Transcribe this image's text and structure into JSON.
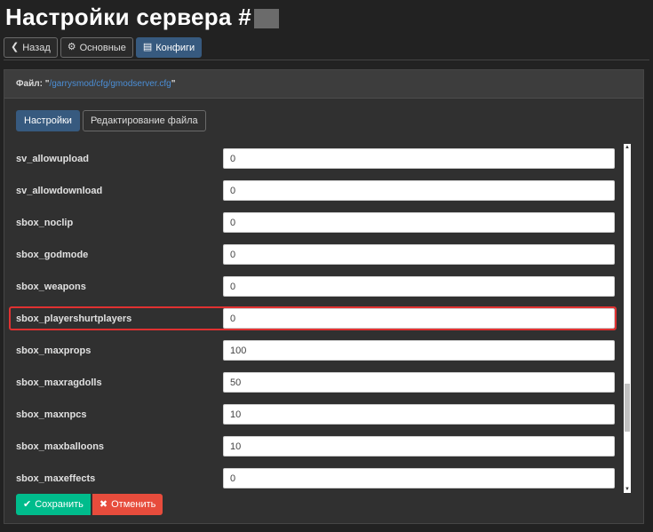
{
  "page": {
    "title": "Настройки сервера #"
  },
  "nav": {
    "back": {
      "icon": "chevron-left-icon",
      "glyph": "❮",
      "label": "Назад"
    },
    "main": {
      "icon": "gear-icon",
      "glyph": "⚙",
      "label": "Основные"
    },
    "configs": {
      "icon": "list-icon",
      "glyph": "▤",
      "label": "Конфиги"
    }
  },
  "file": {
    "prefix": "Файл: \"",
    "path": "/garrysmod/cfg/gmodserver.cfg",
    "suffix": "\""
  },
  "tabs": {
    "settings": "Настройки",
    "edit_file": "Редактирование файла"
  },
  "rows": [
    {
      "label": "sv_allowupload",
      "value": "0"
    },
    {
      "label": "sv_allowdownload",
      "value": "0"
    },
    {
      "label": "sbox_noclip",
      "value": "0"
    },
    {
      "label": "sbox_godmode",
      "value": "0"
    },
    {
      "label": "sbox_weapons",
      "value": "0"
    },
    {
      "label": "sbox_playershurtplayers",
      "value": "0"
    },
    {
      "label": "sbox_maxprops",
      "value": "100"
    },
    {
      "label": "sbox_maxragdolls",
      "value": "50"
    },
    {
      "label": "sbox_maxnpcs",
      "value": "10"
    },
    {
      "label": "sbox_maxballoons",
      "value": "10"
    },
    {
      "label": "sbox_maxeffects",
      "value": "0"
    }
  ],
  "highlighted_row": "sbox_playershurtplayers",
  "actions": {
    "save": {
      "icon": "check-icon",
      "glyph": "✔",
      "label": "Сохранить"
    },
    "cancel": {
      "icon": "close-icon",
      "glyph": "✖",
      "label": "Отменить"
    }
  },
  "scrollbar": {
    "up_glyph": "▲",
    "down_glyph": "▼"
  },
  "colors": {
    "background": "#222222",
    "primary": "#375a7f",
    "success": "#00bc8c",
    "danger": "#e74c3c",
    "highlight": "#e03131",
    "link": "#4b8ed6"
  }
}
